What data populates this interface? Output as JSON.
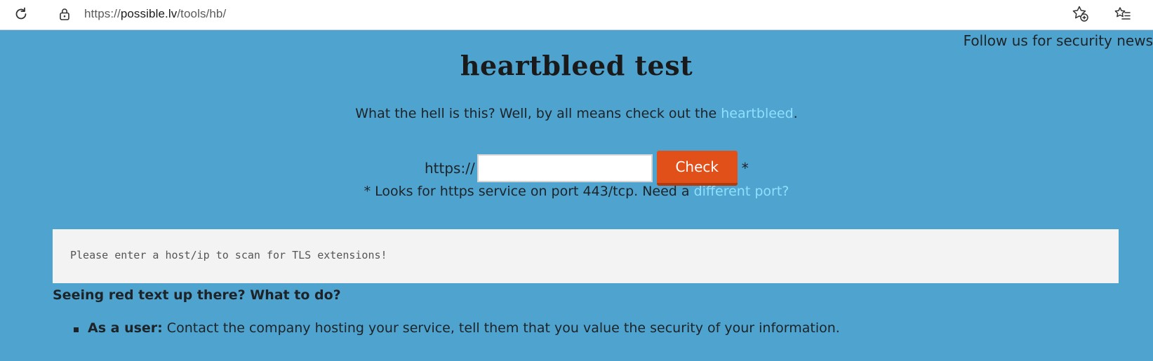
{
  "browser": {
    "url_scheme": "https://",
    "url_host": "possible.lv",
    "url_path": "/tools/hb/",
    "icons": {
      "reload": "reload-icon",
      "lock": "lock-icon",
      "add_favorite": "star-plus-icon",
      "favorites": "favorites-list-icon"
    }
  },
  "page": {
    "follow_text": "Follow us for security news",
    "title": "heartbleed test",
    "intro_text": "What the hell is this? Well, by all means check out the ",
    "intro_link": "heartbleed",
    "intro_suffix": ".",
    "form": {
      "prefix": "https://",
      "host_value": "",
      "check_label": "Check",
      "asterisk": "*"
    },
    "note_text": "* Looks for https service on port 443/tcp. Need a ",
    "note_link": "different port?",
    "result_message": "Please enter a host/ip to scan for TLS extensions!",
    "section_heading": "Seeing red text up there? What to do?",
    "advice": [
      {
        "role": "As a user:",
        "text": " Contact the company hosting your service, tell them that you value the security of your information."
      }
    ]
  },
  "colors": {
    "background": "#4fa3cf",
    "link": "#8fe0ff",
    "check_button": "#e2501a",
    "result_box": "#f3f3f3"
  }
}
